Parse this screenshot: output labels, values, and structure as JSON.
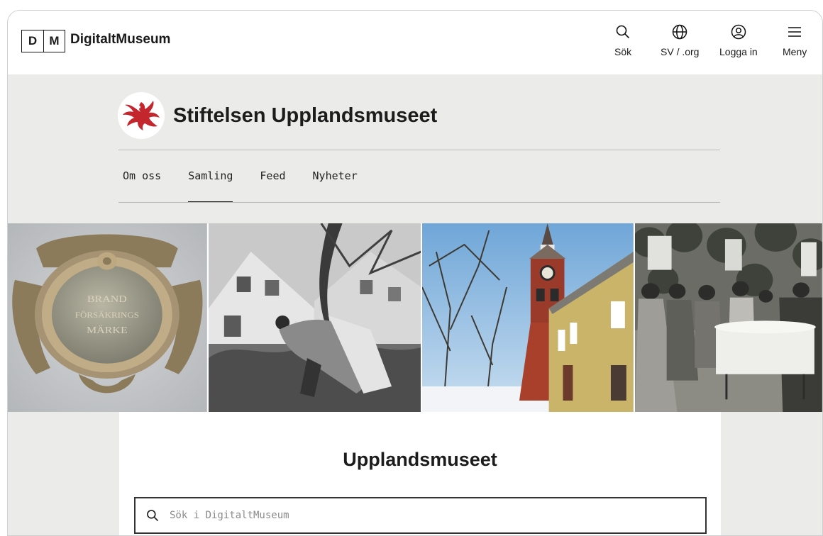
{
  "header": {
    "logo_letters": [
      "D",
      "M"
    ],
    "logo_text": "DigitaltMuseum",
    "actions": [
      {
        "label": "Sök",
        "icon": "search-icon"
      },
      {
        "label": "SV / .org",
        "icon": "globe-icon"
      },
      {
        "label": "Logga in",
        "icon": "user-icon"
      },
      {
        "label": "Meny",
        "icon": "menu-icon"
      }
    ]
  },
  "org": {
    "name": "Stiftelsen Upplandsmuseet",
    "logo_icon": "red-eagle-emblem",
    "tabs": [
      {
        "label": "Om oss",
        "active": false
      },
      {
        "label": "Samling",
        "active": true
      },
      {
        "label": "Feed",
        "active": false
      },
      {
        "label": "Nyheter",
        "active": false
      }
    ]
  },
  "gallery": {
    "plaque_text": [
      "BRAND",
      "FÖRSÄKRINGS",
      "MÄRKE"
    ]
  },
  "search": {
    "title": "Upplandsmuseet",
    "placeholder": "Sök i DigitaltMuseum"
  },
  "colors": {
    "page_bg": "#ebebea",
    "emblem_red": "#c4262e",
    "text": "#1c1c1c"
  }
}
